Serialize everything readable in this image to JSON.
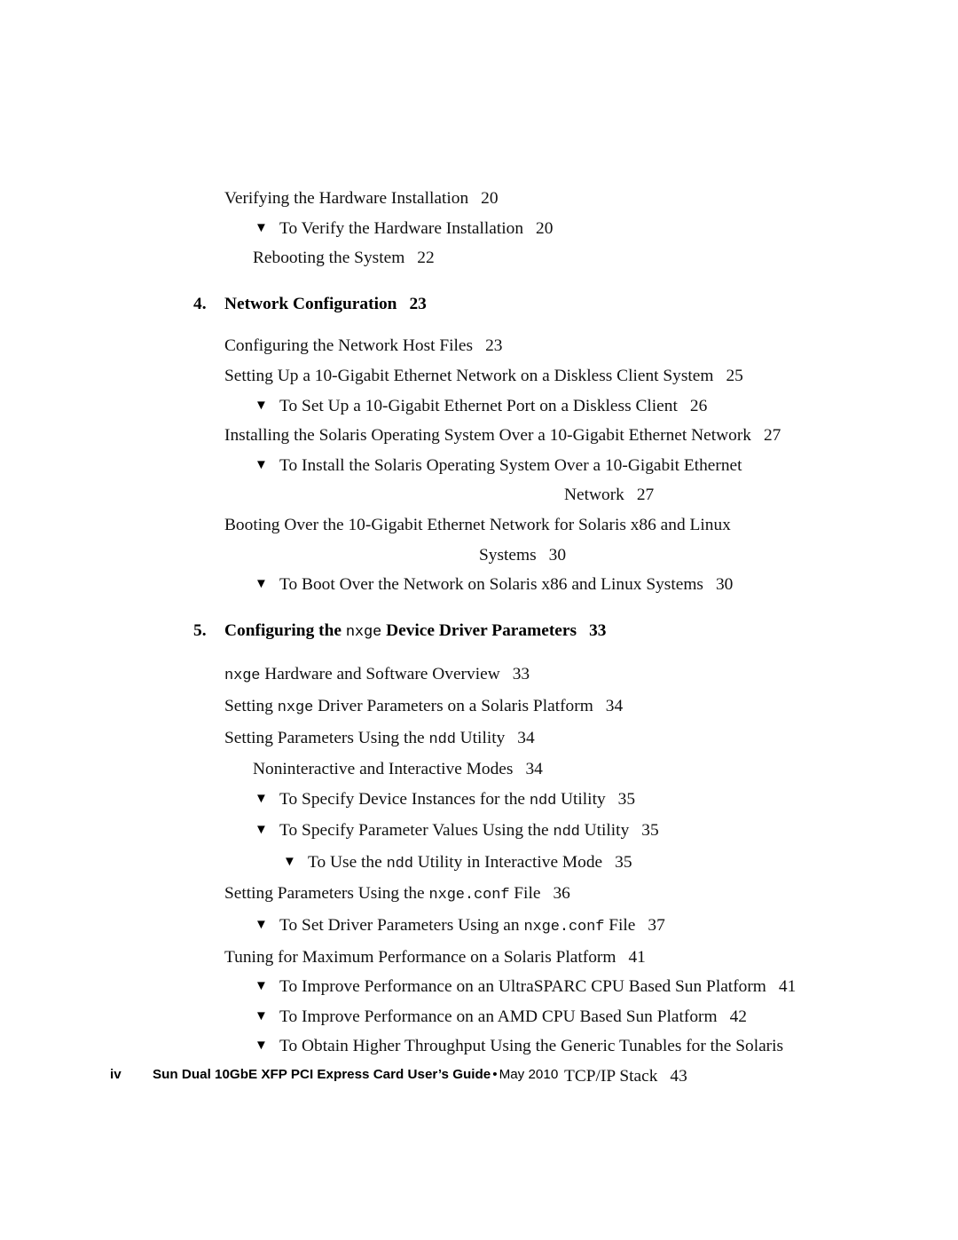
{
  "document": {
    "page_label": "iv",
    "footer_title": "Sun Dual 10GbE XFP PCI Express Card User’s Guide",
    "footer_separator": "•",
    "footer_date": "May 2010"
  },
  "icons": {
    "procedure_bullet": "▼"
  },
  "toc": {
    "entries": [
      {
        "kind": "section",
        "text": "Verifying the Hardware Installation",
        "page": "20"
      },
      {
        "kind": "procedure",
        "text": "To Verify the Hardware Installation",
        "page": "20"
      },
      {
        "kind": "subsection",
        "text": "Rebooting the System",
        "page": "22"
      },
      {
        "kind": "chapter",
        "number": "4.",
        "text": "Network Configuration",
        "page": "23"
      },
      {
        "kind": "section",
        "text": "Configuring the Network Host Files",
        "page": "23"
      },
      {
        "kind": "section",
        "text": "Setting Up a 10-Gigabit Ethernet Network on a Diskless Client System",
        "page": "25"
      },
      {
        "kind": "procedure",
        "text": "To Set Up a 10-Gigabit Ethernet Port on a Diskless Client",
        "page": "26"
      },
      {
        "kind": "section",
        "text": "Installing the Solaris Operating System Over a 10-Gigabit Ethernet Network",
        "page": "27"
      },
      {
        "kind": "procedure",
        "line1": "To Install the Solaris Operating System Over a 10-Gigabit Ethernet",
        "line2": "Network",
        "page": "27"
      },
      {
        "kind": "section",
        "line1": "Booting Over the 10-Gigabit Ethernet Network for Solaris x86 and Linux",
        "line2": "Systems",
        "page": "30"
      },
      {
        "kind": "procedure",
        "text": "To Boot Over the Network on Solaris x86 and Linux Systems",
        "page": "30"
      },
      {
        "kind": "chapter",
        "number": "5.",
        "text_before": "Configuring the",
        "mono": "nxge",
        "text_after": "Device Driver Parameters",
        "page": "33"
      },
      {
        "kind": "section",
        "mono_lead": "nxge",
        "text_after": "Hardware and Software Overview",
        "page": "33"
      },
      {
        "kind": "section",
        "text_before": "Setting",
        "mono": "nxge",
        "text_after": "Driver Parameters on a Solaris Platform",
        "page": "34"
      },
      {
        "kind": "section",
        "text_before": "Setting Parameters Using the",
        "mono": "ndd",
        "text_after": "Utility",
        "page": "34"
      },
      {
        "kind": "subsection",
        "text": "Noninteractive and Interactive Modes",
        "page": "34"
      },
      {
        "kind": "procedure",
        "text_before": "To Specify Device Instances for the",
        "mono": "ndd",
        "text_after": "Utility",
        "page": "35"
      },
      {
        "kind": "procedure",
        "text_before": "To Specify Parameter Values Using the",
        "mono": "ndd",
        "text_after": "Utility",
        "page": "35"
      },
      {
        "kind": "procedure-deep",
        "text_before": "To Use the",
        "mono": "ndd",
        "text_after": "Utility in Interactive Mode",
        "page": "35"
      },
      {
        "kind": "section",
        "text_before": "Setting Parameters Using the",
        "mono": "nxge.conf",
        "text_after": "File",
        "page": "36"
      },
      {
        "kind": "procedure",
        "text_before": "To Set Driver Parameters Using an",
        "mono": "nxge.conf",
        "text_after": "File",
        "page": "37"
      },
      {
        "kind": "section",
        "text": "Tuning for Maximum Performance on a Solaris Platform",
        "page": "41"
      },
      {
        "kind": "procedure",
        "text": "To Improve Performance on an UltraSPARC CPU Based Sun Platform",
        "page": "41"
      },
      {
        "kind": "procedure",
        "text": "To Improve Performance on an AMD CPU Based Sun Platform",
        "page": "42"
      },
      {
        "kind": "procedure",
        "line1": "To Obtain Higher Throughput Using the Generic Tunables for the Solaris",
        "line2": "TCP/IP Stack",
        "page": "43"
      }
    ]
  }
}
